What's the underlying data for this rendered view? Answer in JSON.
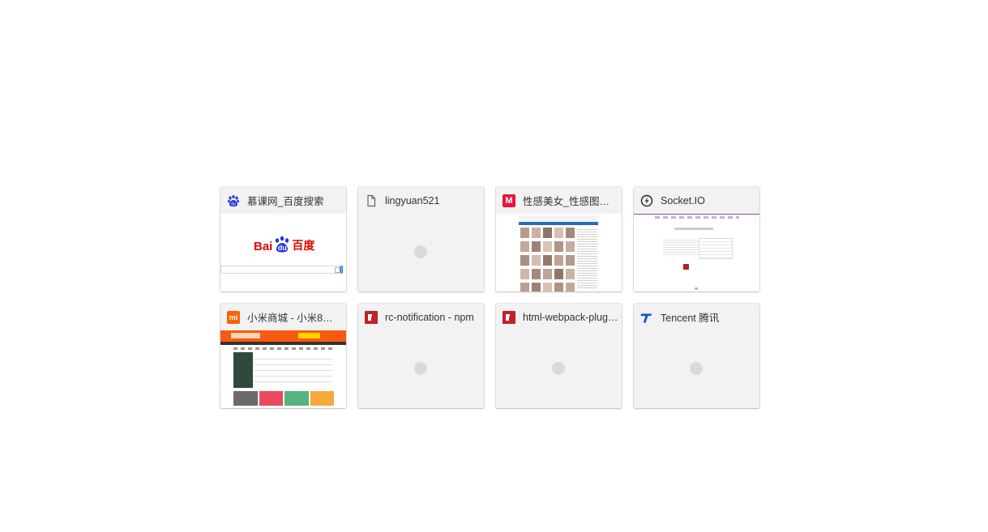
{
  "tiles": [
    {
      "title": "慕课网_百度搜索",
      "icon": "baidu-paw-icon",
      "thumb_logo": {
        "bai": "Bai",
        "du": "du",
        "cn": "百度"
      }
    },
    {
      "title": "lingyuan521",
      "icon": "document-icon"
    },
    {
      "title": "性感美女_性感图片…",
      "icon": "m-site-icon",
      "icon_text": "M"
    },
    {
      "title": "Socket.IO",
      "icon": "socketio-icon"
    },
    {
      "title": "小米商城 - 小米8、…",
      "icon": "mi-icon",
      "icon_text": "mi"
    },
    {
      "title": "rc-notification - npm",
      "icon": "npm-icon"
    },
    {
      "title": "html-webpack-plugi…",
      "icon": "npm-icon"
    },
    {
      "title": "Tencent 腾讯",
      "icon": "tencent-icon"
    }
  ],
  "colors": {
    "baidu_red": "#e10601",
    "baidu_blue": "#2932e1",
    "mi_orange": "#f56600",
    "npm_red": "#c12127",
    "tencent_blue": "#0052d9"
  }
}
